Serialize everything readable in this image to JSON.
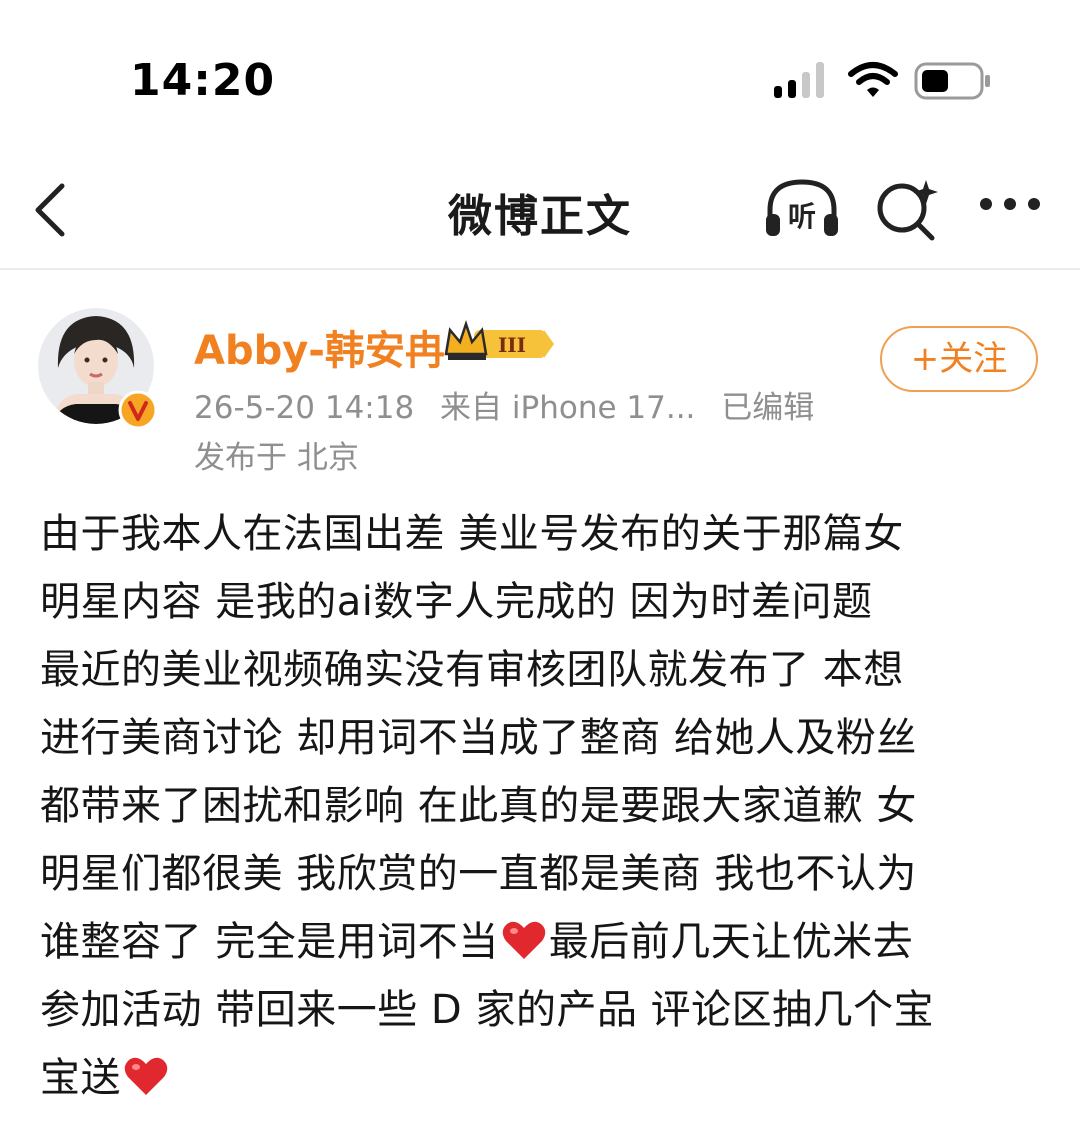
{
  "status_bar": {
    "time": "14:20",
    "signal_icon": "signal-bars-icon",
    "wifi_icon": "wifi-icon",
    "battery_icon": "battery-icon"
  },
  "nav": {
    "title": "微博正文",
    "back_icon": "chevron-left-icon",
    "listen_label": "听",
    "listen_icon": "headphones-icon",
    "search_icon": "search-sparkle-icon",
    "more_icon": "more-dots-icon"
  },
  "post": {
    "author": {
      "name": "Abby-韩安冉",
      "crown_label": "III",
      "verified": true
    },
    "meta": {
      "timestamp": "26-5-20 14:18",
      "source": "来自 iPhone 17...",
      "edited": "已编辑"
    },
    "location": "发布于 北京",
    "follow_label": "+关注",
    "body_lines": [
      "由于我本人在法国出差 美业号发布的关于那篇女",
      "明星内容 是我的ai数字人完成的 因为时差问题",
      "最近的美业视频确实没有审核团队就发布了 本想",
      "进行美商讨论 却用词不当成了整商 给她人及粉丝",
      "都带来了困扰和影响 在此真的是要跟大家道歉 女",
      "明星们都很美 我欣赏的一直都是美商 我也不认为"
    ],
    "line7_before_heart": "谁整容了 完全是用词不当",
    "line7_after_heart": "最后前几天让优米去",
    "line8": "参加活动 带回来一些 D 家的产品 评论区抽几个宝",
    "line9_before_heart": "宝送",
    "heart_icon": "red-heart-emoji"
  },
  "colors": {
    "accent": "#f08020",
    "follow_border": "#f0a050",
    "meta_gray": "#8f8f8f",
    "heart": "#e0282e"
  }
}
